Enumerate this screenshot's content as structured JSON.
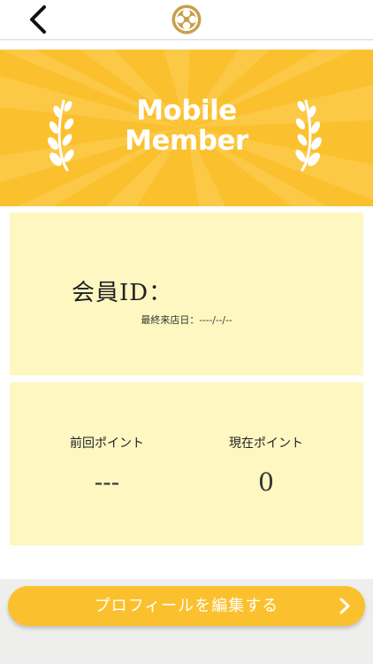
{
  "header": {
    "back_icon": "chevron-left-icon",
    "logo_icon": "flower-crest-icon"
  },
  "banner": {
    "title_line1": "Mobile",
    "title_line2": "Member",
    "background_color": "#fbc02d",
    "ray_color": "#fccb4a"
  },
  "member": {
    "id_label": "会員ID：",
    "last_visit": "最終来店日：----/--/--"
  },
  "points": {
    "previous_label": "前回ポイント",
    "previous_value": "---",
    "current_label": "現在ポイント",
    "current_value": "0"
  },
  "edit_profile": {
    "label": "プロフィールを編集する",
    "icon": "chevron-right-icon"
  },
  "colors": {
    "accent": "#fbc02d",
    "panel": "#fef7c2"
  }
}
